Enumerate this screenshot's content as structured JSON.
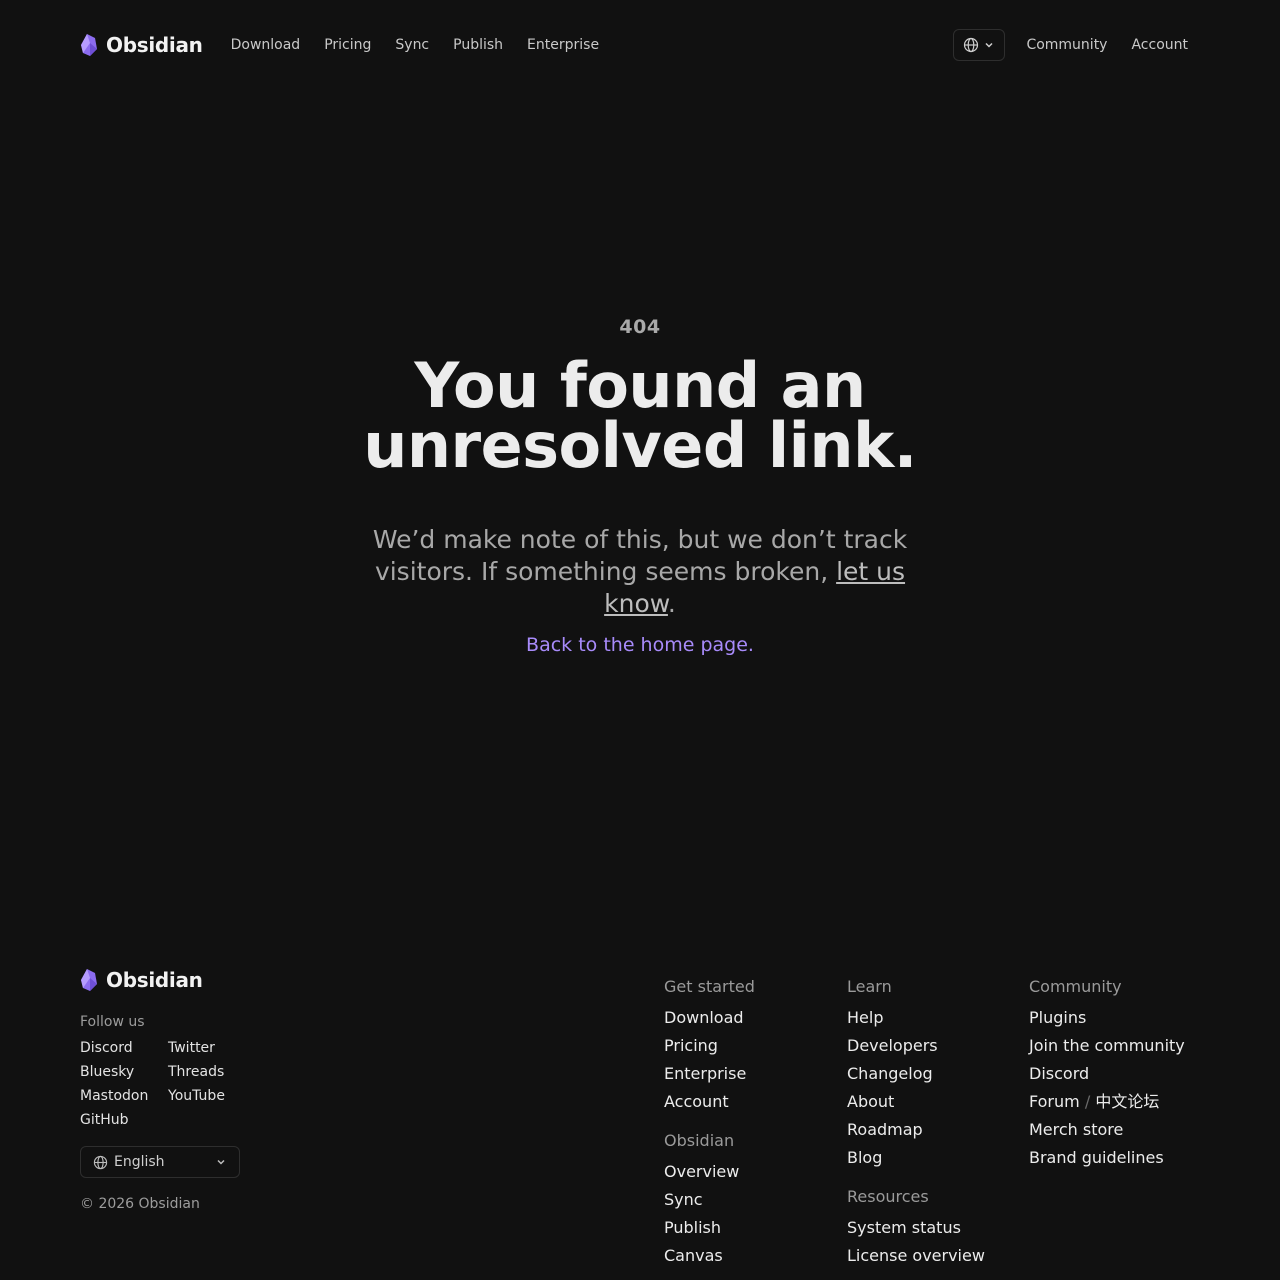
{
  "brand": {
    "name": "Obsidian",
    "accent": "#a88bfa"
  },
  "nav": {
    "links": [
      "Download",
      "Pricing",
      "Sync",
      "Publish",
      "Enterprise"
    ],
    "right": {
      "community": "Community",
      "account": "Account"
    }
  },
  "hero": {
    "code": "404",
    "title_line1": "You found an",
    "title_line2": "unresolved link.",
    "lead_before": "We’d make note of this, but we don’t track visitors. If something seems broken, ",
    "lead_link": "let us know",
    "lead_after": ".",
    "home_link": "Back to the home page."
  },
  "footer": {
    "brand": "Obsidian",
    "follow_label": "Follow us",
    "social": [
      "Discord",
      "Twitter",
      "Bluesky",
      "Threads",
      "Mastodon",
      "YouTube",
      "GitHub"
    ],
    "language": "English",
    "copyright": "© 2026 Obsidian",
    "get_started": {
      "title": "Get started",
      "items": [
        "Download",
        "Pricing",
        "Enterprise",
        "Account"
      ]
    },
    "obsidian": {
      "title": "Obsidian",
      "items": [
        "Overview",
        "Sync",
        "Publish",
        "Canvas"
      ]
    },
    "learn": {
      "title": "Learn",
      "items": [
        "Help",
        "Developers",
        "Changelog",
        "About",
        "Roadmap",
        "Blog"
      ]
    },
    "resources": {
      "title": "Resources",
      "items": [
        "System status",
        "License overview"
      ]
    },
    "community": {
      "title": "Community",
      "items": [
        "Plugins",
        "Join the community",
        "Discord"
      ],
      "forum": "Forum",
      "forum_sep": "/",
      "forum_cn": "中文论坛",
      "items2": [
        "Merch store",
        "Brand guidelines"
      ]
    }
  }
}
